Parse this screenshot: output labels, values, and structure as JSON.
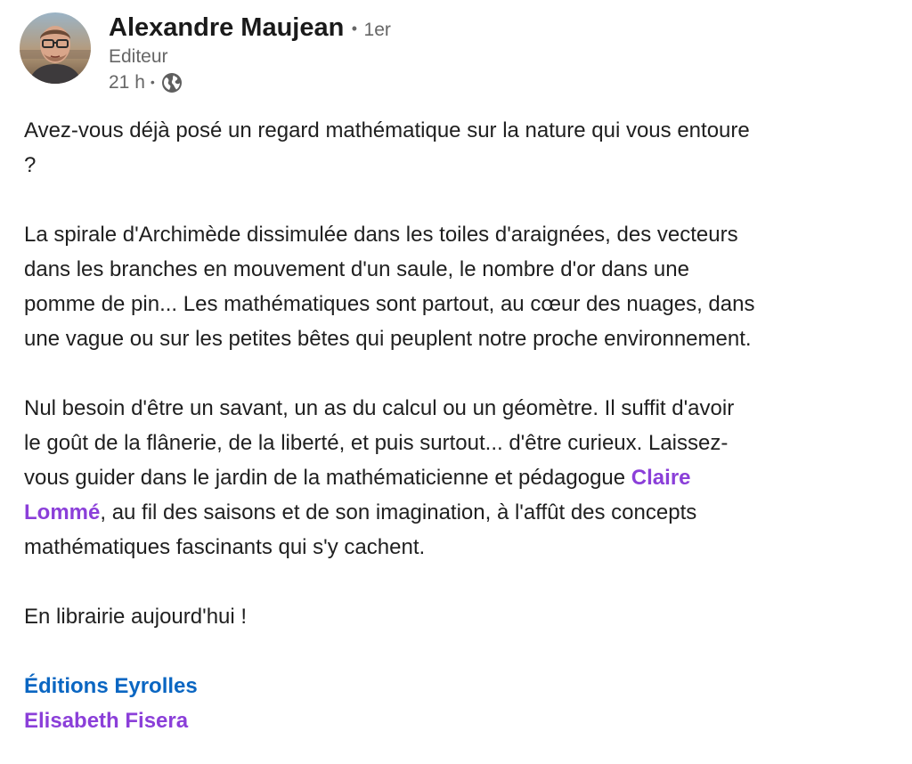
{
  "author": {
    "name": "Alexandre Maujean",
    "separator": "•",
    "degree": "1er",
    "headline": "Editeur",
    "time": "21 h",
    "time_separator": "•",
    "visibility_icon": "globe-icon"
  },
  "post": {
    "question_line1": "Avez-vous déjà posé un regard mathématique sur la nature qui vous entoure",
    "question_line2": "?",
    "para2": [
      "La spirale d'Archimède dissimulée dans les toiles d'araignées, des vecteurs",
      "dans les branches en mouvement d'un saule, le nombre d'or dans une",
      "pomme de pin... Les mathématiques sont partout, au cœur des nuages, dans",
      "une vague ou sur les petites bêtes qui peuplent notre proche environnement."
    ],
    "para3": {
      "line1": "Nul besoin d'être un savant, un as du calcul ou un géomètre. Il suffit d'avoir",
      "line2": "le goût de la flânerie, de la liberté, et puis surtout... d'être curieux. Laissez-",
      "line3_before": "vous guider dans le jardin de la mathématicienne et pédagogue ",
      "mention_part1": "Claire",
      "mention_part2": "Lommé",
      "line4_after": ", au fil des saisons et de son imagination, à l'affût des concepts",
      "line5": "mathématiques fascinants qui s'y cachent."
    },
    "para4": "En librairie aujourd'hui !",
    "tag_company": "Éditions Eyrolles",
    "tag_person": "Elisabeth Fisera"
  },
  "colors": {
    "mention": "#8b3fd9",
    "company_link": "#0a66c2",
    "secondary_text": "#666666"
  }
}
